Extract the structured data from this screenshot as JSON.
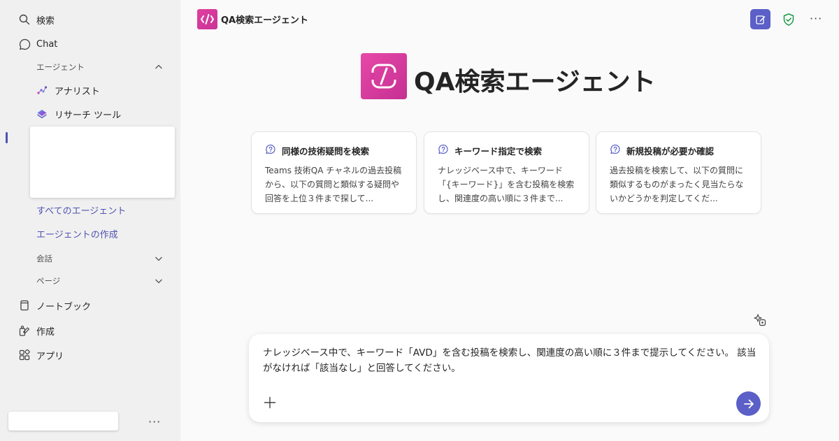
{
  "sidebar": {
    "search_label": "検索",
    "chat_label": "Chat",
    "agents_section_label": "エージェント",
    "agents": [
      {
        "label": "アナリスト",
        "icon": "analyst-icon"
      },
      {
        "label": "リサーチ ツール",
        "icon": "research-tool-icon"
      }
    ],
    "all_agents_label": "すべてのエージェント",
    "create_agent_label": "エージェントの作成",
    "conversations_label": "会話",
    "pages_label": "ページ",
    "notebook_label": "ノートブック",
    "create_label": "作成",
    "apps_label": "アプリ",
    "more_label": "···"
  },
  "header": {
    "title": "QA検索エージェント",
    "more_label": "···"
  },
  "hero": {
    "title": "QA検索エージェント"
  },
  "cards": [
    {
      "title": "同様の技術疑問を検索",
      "body": "Teams 技術QA チャネルの過去投稿から、以下の質問と類似する疑問や回答を上位３件まで探して..."
    },
    {
      "title": "キーワード指定で検索",
      "body": "ナレッジベース中で、キーワード「{キーワード}」を含む投稿を検索し、関連度の高い順に３件まで..."
    },
    {
      "title": "新規投稿が必要か確認",
      "body": "過去投稿を検索して、以下の質問に類似するものがまったく見当たらないかどうかを判定してくだ..."
    }
  ],
  "composer": {
    "message": "ナレッジベース中で、キーワード「AVD」を含む投稿を検索し、関連度の高い順に３件まで提示してください。 該当がなければ「該当なし」と回答してください。"
  },
  "colors": {
    "accent": "#5b5fc7",
    "link": "#4f52b2",
    "brand_pink": "#d63a9c"
  }
}
